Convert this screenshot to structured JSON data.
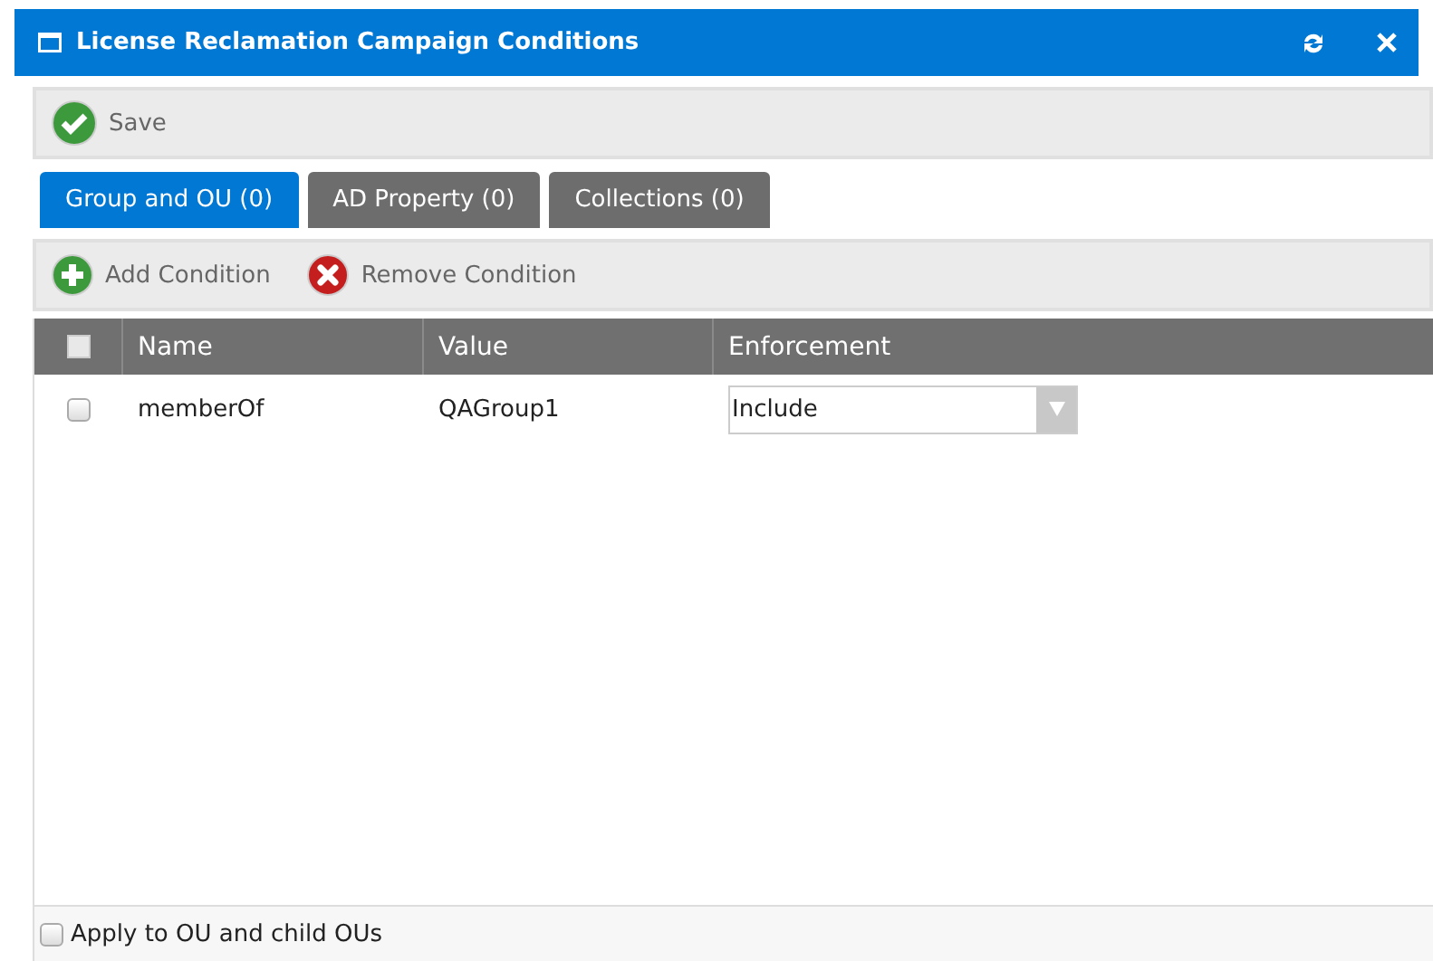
{
  "window": {
    "title": "License Reclamation Campaign Conditions"
  },
  "toolbar": {
    "save": "Save"
  },
  "tabs": [
    {
      "label": "Group and OU (0)",
      "selected": true
    },
    {
      "label": "AD Property (0)",
      "selected": false
    },
    {
      "label": "Collections (0)",
      "selected": false
    }
  ],
  "actions": [
    {
      "kind": "add",
      "label": "Add Condition"
    },
    {
      "kind": "remove",
      "label": "Remove Condition"
    }
  ],
  "table": {
    "select_all_checked": false,
    "columns": [
      "Name",
      "Value",
      "Enforcement"
    ],
    "rows": [
      {
        "checked": false,
        "name": "memberOf",
        "value": "QAGroup1",
        "enforcement": "Include"
      }
    ]
  },
  "apply_child_ous": {
    "label": "Apply to OU and child OUs",
    "checked": false
  }
}
